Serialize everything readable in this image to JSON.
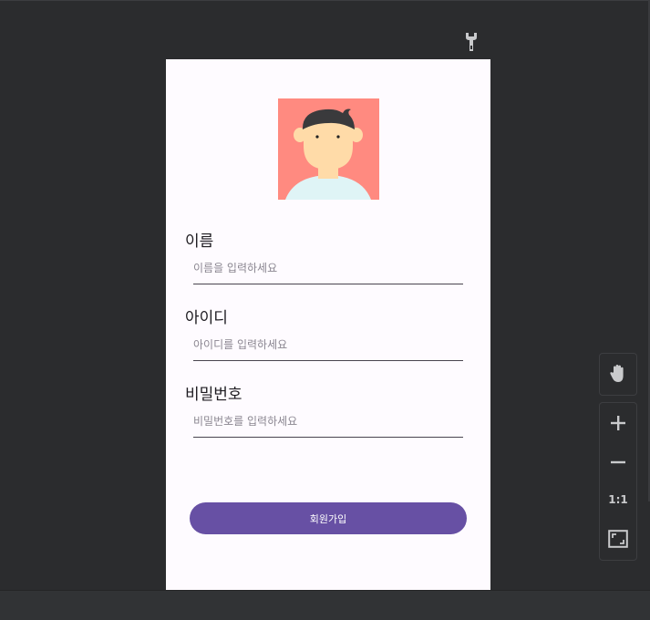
{
  "form": {
    "name_label": "이름",
    "name_placeholder": "이름을 입력하세요",
    "id_label": "아이디",
    "id_placeholder": "아이디를 입력하세요",
    "password_label": "비밀번호",
    "password_placeholder": "비밀번호를 입력하세요",
    "signup_button": "회원가입"
  },
  "toolbar": {
    "pan_icon": "hand-icon",
    "zoom_in_icon": "plus-icon",
    "zoom_out_icon": "minus-icon",
    "actual_size_label": "1:1",
    "fit_screen_icon": "fit-screen-icon",
    "settings_icon": "wrench-icon"
  },
  "colors": {
    "background": "#2b2c2e",
    "screen": "#fefbff",
    "primary": "#6750a4",
    "avatar_bg": "#ff8a80",
    "skin": "#ffdba8"
  }
}
